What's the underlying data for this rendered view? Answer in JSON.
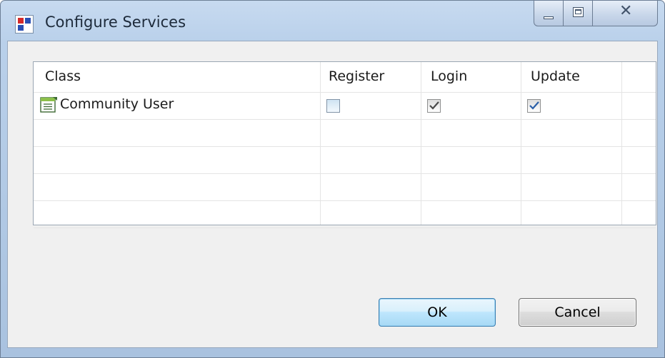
{
  "window": {
    "title": "Configure Services",
    "app_icon": "app-logo-icon",
    "caption_buttons": [
      "minimize-icon",
      "maximize-icon",
      "close-icon"
    ]
  },
  "table": {
    "columns": [
      "Class",
      "Register",
      "Login",
      "Update"
    ],
    "rows": [
      {
        "icon": "class-document-icon",
        "label": "Community User",
        "register": false,
        "login": true,
        "update": true
      }
    ]
  },
  "buttons": {
    "ok_label": "OK",
    "cancel_label": "Cancel"
  },
  "colors": {
    "accent": "#3c7fb1",
    "check_login": "#4a4a4a",
    "check_update": "#2a5fa8"
  }
}
